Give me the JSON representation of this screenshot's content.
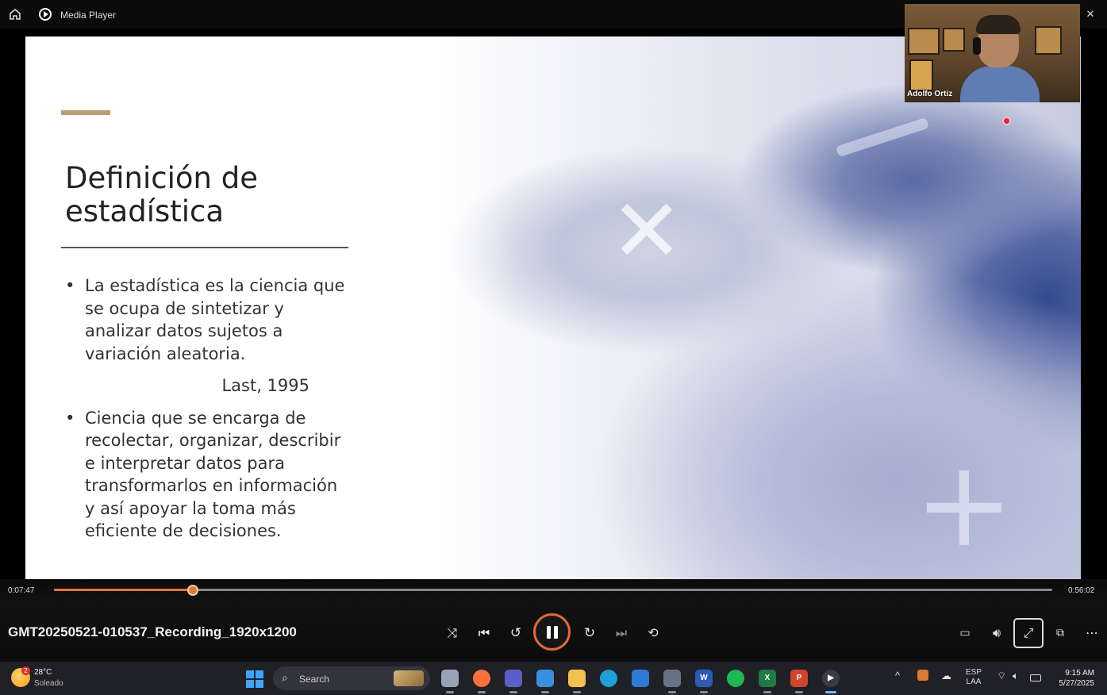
{
  "window": {
    "title": "Media Player",
    "controls": {
      "minimize": "—",
      "restore": "❐",
      "close": "✕"
    }
  },
  "slide": {
    "title": "Definición de estadística",
    "bullets": [
      "La estadística es la ciencia que se ocupa de sintetizar  y analizar datos sujetos a variación aleatoria.",
      "Ciencia que se encarga de recolectar, organizar, describir e interpretar datos para transformarlos en información y así apoyar la toma más eficiente de decisiones."
    ],
    "citation": "Last, 1995",
    "accent_color": "#b99c6f"
  },
  "webcam": {
    "participant_name": "Adolfo Ortiz"
  },
  "player": {
    "current_time": "0:07:47",
    "total_time": "0:56:02",
    "progress_fraction": 0.1388,
    "file_name": "GMT20250521-010537_Recording_1920x1200",
    "accent_color": "#e0683a",
    "icons": {
      "shuffle": "shuffle-icon",
      "previous": "previous-icon",
      "rewind": "rewind-10-icon",
      "play_pause": "pause-icon",
      "forward": "forward-30-icon",
      "next": "next-icon",
      "repeat": "repeat-off-icon",
      "subtitles": "subtitles-icon",
      "volume": "volume-icon",
      "fullscreen": "fullscreen-icon",
      "miniplayer": "miniplayer-icon",
      "more": "more-icon"
    }
  },
  "taskbar": {
    "weather": {
      "temp": "28°C",
      "description": "Soleado",
      "badge": "2"
    },
    "search_label": "Search",
    "apps": [
      {
        "name": "task-view",
        "color": "#9aa3b5",
        "glyph": ""
      },
      {
        "name": "firefox",
        "color": "#ff7139",
        "glyph": ""
      },
      {
        "name": "teams",
        "color": "#5b5fc7",
        "glyph": ""
      },
      {
        "name": "copilot",
        "color": "#3a8fe0",
        "glyph": ""
      },
      {
        "name": "file-explorer",
        "color": "#f2c14b",
        "glyph": ""
      },
      {
        "name": "edge",
        "color": "#1fa0d8",
        "glyph": ""
      },
      {
        "name": "store",
        "color": "#2d7bd6",
        "glyph": ""
      },
      {
        "name": "calculator",
        "color": "#6a7385",
        "glyph": ""
      },
      {
        "name": "word",
        "color": "#2b5cb5",
        "glyph": "W"
      },
      {
        "name": "spotify",
        "color": "#1db954",
        "glyph": ""
      },
      {
        "name": "excel",
        "color": "#1f7a45",
        "glyph": "X"
      },
      {
        "name": "powerpoint",
        "color": "#d0442a",
        "glyph": "P"
      },
      {
        "name": "media-player",
        "color": "#3a3a44",
        "glyph": "▶"
      }
    ],
    "language": {
      "line1": "ESP",
      "line2": "LAA"
    },
    "time": "9:15 AM",
    "date": "5/27/2025"
  }
}
